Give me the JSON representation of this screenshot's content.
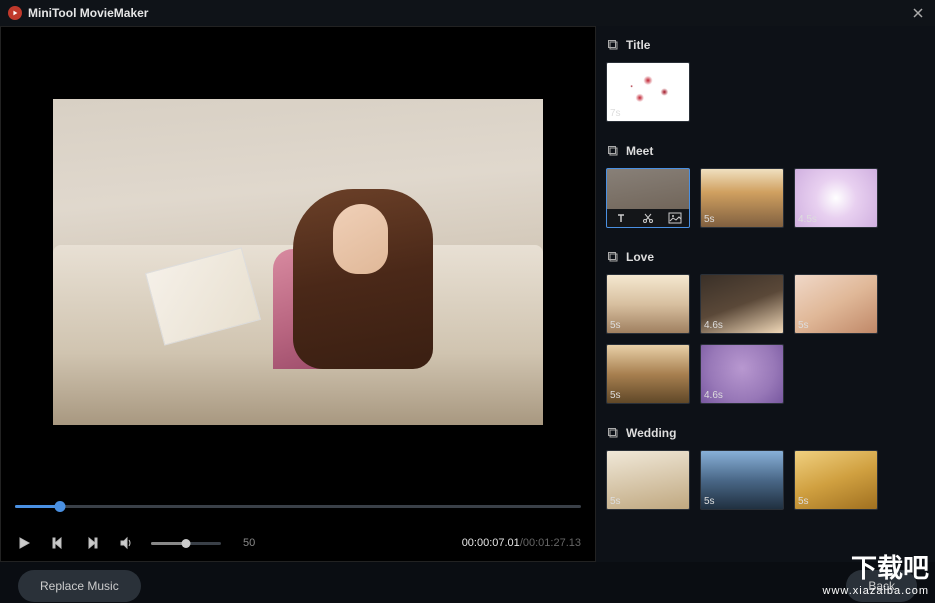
{
  "app": {
    "title": "MiniTool MovieMaker"
  },
  "player": {
    "current_time": "00:00:07.01",
    "total_time": "00:01:27.13",
    "progress_percent": 8,
    "volume": 50
  },
  "sections": [
    {
      "name": "Title",
      "clips": [
        {
          "duration": "7s",
          "thumb": "thumb-title",
          "selected": false
        }
      ]
    },
    {
      "name": "Meet",
      "clips": [
        {
          "duration": "",
          "thumb": "thumb-meet1",
          "selected": true
        },
        {
          "duration": "5s",
          "thumb": "thumb-meet2",
          "selected": false
        },
        {
          "duration": "4.5s",
          "thumb": "thumb-meet3",
          "selected": false
        }
      ]
    },
    {
      "name": "Love",
      "clips": [
        {
          "duration": "5s",
          "thumb": "thumb-love1",
          "selected": false
        },
        {
          "duration": "4.6s",
          "thumb": "thumb-love2",
          "selected": false
        },
        {
          "duration": "5s",
          "thumb": "thumb-love3",
          "selected": false
        },
        {
          "duration": "5s",
          "thumb": "thumb-love4",
          "selected": false
        },
        {
          "duration": "4.6s",
          "thumb": "thumb-love5",
          "selected": false
        }
      ]
    },
    {
      "name": "Wedding",
      "clips": [
        {
          "duration": "5s",
          "thumb": "thumb-wed1",
          "selected": false
        },
        {
          "duration": "5s",
          "thumb": "thumb-wed2",
          "selected": false
        },
        {
          "duration": "5s",
          "thumb": "thumb-wed3",
          "selected": false
        }
      ]
    }
  ],
  "buttons": {
    "replace_music": "Replace Music",
    "back": "Back"
  },
  "watermark": {
    "main": "下载吧",
    "sub": "www.xiazaiba.com"
  }
}
